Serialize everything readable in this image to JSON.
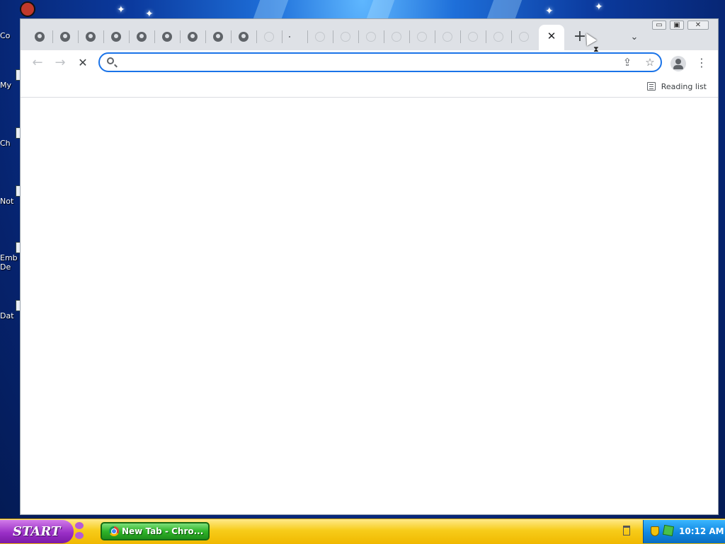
{
  "desktop": {
    "icons": [
      {
        "label": "Co"
      },
      {
        "label": "My"
      },
      {
        "label": "Ch"
      },
      {
        "label": "Not"
      },
      {
        "label": "Emb De"
      },
      {
        "label": "Dat"
      }
    ]
  },
  "browser": {
    "tabs": {
      "active_close_glyph": "✕",
      "new_tab_glyph": "+",
      "tab_search_glyph": "⌄"
    },
    "window_controls": {
      "minimize": "▭",
      "restore": "▣",
      "close": "✕"
    },
    "toolbar": {
      "back_glyph": "←",
      "forward_glyph": "→",
      "stop_glyph": "✕",
      "omnibox_value": "",
      "omnibox_placeholder": "",
      "share_glyph": "⇪",
      "star_glyph": "☆",
      "menu_glyph": "⋮"
    },
    "bookmarks_bar": {
      "reading_list_label": "Reading list"
    }
  },
  "taskbar": {
    "start_label": "START",
    "task_label": "New Tab - Chro...",
    "clock": "10:12 AM"
  },
  "colors": {
    "accent": "#1a73e8",
    "tabstrip": "#dee1e6",
    "taskbar": "#f7cc1a",
    "start": "#9a2fc7",
    "tray": "#1187e0"
  }
}
